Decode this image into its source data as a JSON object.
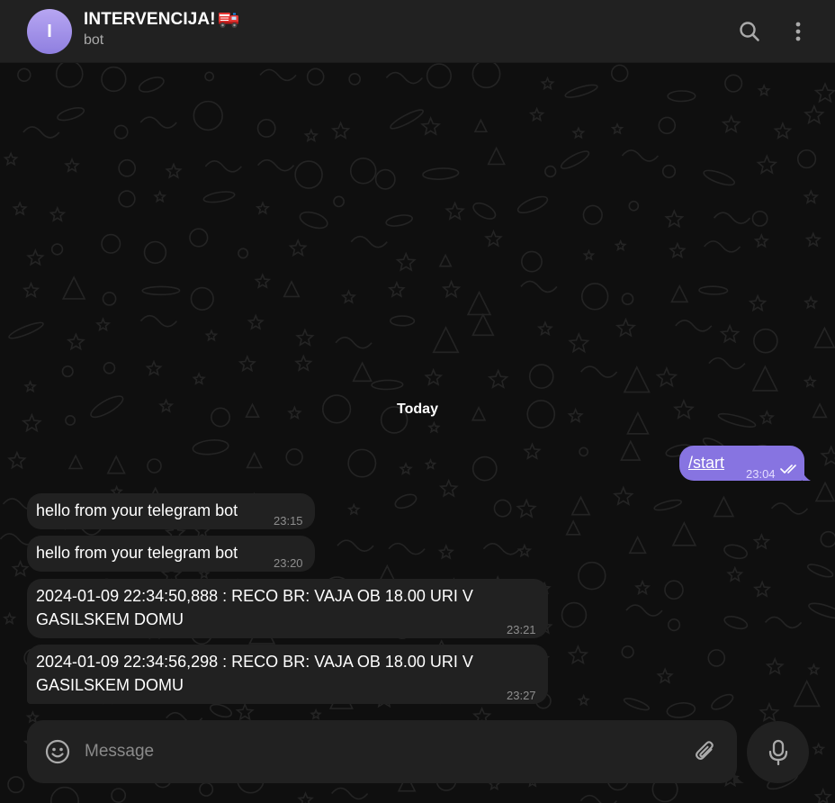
{
  "header": {
    "avatar_letter": "I",
    "title": "INTERVENCIJA!",
    "title_emoji": "fire-engine-icon",
    "subtitle": "bot",
    "icons": [
      "search-icon",
      "more-vertical-icon"
    ]
  },
  "date_separator": "Today",
  "messages": [
    {
      "direction": "outgoing",
      "text": "/start",
      "time": "23:04",
      "status": "read-double-check"
    },
    {
      "direction": "incoming",
      "text": "hello from your telegram bot",
      "time": "23:15"
    },
    {
      "direction": "incoming",
      "text": "hello from your telegram bot",
      "time": "23:20"
    },
    {
      "direction": "incoming",
      "text_line1": "2024-01-09 22:34:50,888 : RECO BR: VAJA OB 18.00 URI V",
      "text_line2": "GASILSKEM DOMU",
      "time": "23:21"
    },
    {
      "direction": "incoming",
      "text_line1": "2024-01-09 22:34:56,298 : RECO BR: VAJA OB 18.00 URI V",
      "text_line2": "GASILSKEM DOMU",
      "time": "23:27"
    }
  ],
  "composer": {
    "placeholder": "Message",
    "icons": [
      "emoji-icon",
      "paperclip-icon",
      "microphone-icon"
    ]
  },
  "colors": {
    "accent": "#8774e1",
    "header_bg": "#212121",
    "bubble_in": "#212121",
    "chat_bg": "#0f0f0f"
  }
}
